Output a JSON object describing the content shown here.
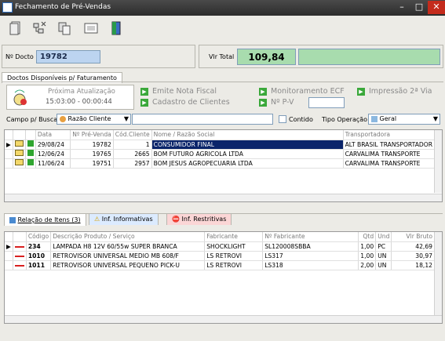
{
  "window": {
    "title": "Fechamento de Pré-Vendas"
  },
  "header": {
    "ndocto_label": "Nº Docto",
    "ndocto_value": "19782",
    "vlrtotal_label": "Vlr Total",
    "vlrtotal_value": "109,84"
  },
  "main_tab": "Doctos Disponíveis p/ Faturamento",
  "update_box": {
    "label": "Próxima Atualização",
    "time": "15:03:00 - 00:00:44"
  },
  "actions": {
    "emit_nf": "Emite Nota Fiscal",
    "monitor_ecf": "Monitoramento ECF",
    "print_2via": "Impressão 2ª Via",
    "cadastro": "Cadastro de Clientes",
    "npv": "Nº P-V"
  },
  "search": {
    "field_label": "Campo p/ Busca",
    "field_value": "Razão Cliente",
    "contido_label": "Contido",
    "op_label": "Tipo Operação",
    "op_value": "Geral"
  },
  "doc_table": {
    "headers": [
      "Data",
      "Nº Pré-Venda",
      "Cód.Cliente",
      "Nome / Razão Social",
      "Transportadora"
    ],
    "rows": [
      {
        "date": "29/08/24",
        "num": "19782",
        "cod": "1",
        "name": "CONSUMIDOR FINAL",
        "carrier": "ALT BRASIL TRANSPORTADOR"
      },
      {
        "date": "12/06/24",
        "num": "19765",
        "cod": "2665",
        "name": "BOM FUTURO AGRICOLA LTDA",
        "carrier": "CARVALIMA TRANSPORTE"
      },
      {
        "date": "11/06/24",
        "num": "19751",
        "cod": "2957",
        "name": "BOM JESUS AGROPECUARIA LTDA",
        "carrier": "CARVALIMA TRANSPORTE"
      }
    ]
  },
  "item_tabs": [
    "Relação de Itens (3)",
    "Inf. Informativas",
    "Inf. Restritivas"
  ],
  "item_table": {
    "headers": [
      "Código",
      "Descrição Produto / Serviço",
      "Fabricante",
      "Nº Fabricante",
      "Qtd",
      "Und",
      "Vlr Bruto"
    ],
    "rows": [
      {
        "code": "234",
        "desc": "LAMPADA H8 12V 60/55w SUPER BRANCA",
        "mfr": "SHOCKLIGHT",
        "mfrno": "SL120008SBBA",
        "qty": "1,00",
        "unit": "PC",
        "price": "42,69"
      },
      {
        "code": "1010",
        "desc": "RETROVISOR UNIVERSAL MEDIO MB 608/F",
        "mfr": "LS RETROVI",
        "mfrno": "LS317",
        "qty": "1,00",
        "unit": "UN",
        "price": "30,97"
      },
      {
        "code": "1011",
        "desc": "RETROVISOR UNIVERSAL PEQUENO PICK-U",
        "mfr": "LS RETROVI",
        "mfrno": "LS318",
        "qty": "2,00",
        "unit": "UN",
        "price": "18,12"
      }
    ]
  },
  "colors": {
    "selection": "#0a246a",
    "total_bg": "#a8dcae",
    "docto_bg": "#bcd4f0"
  }
}
